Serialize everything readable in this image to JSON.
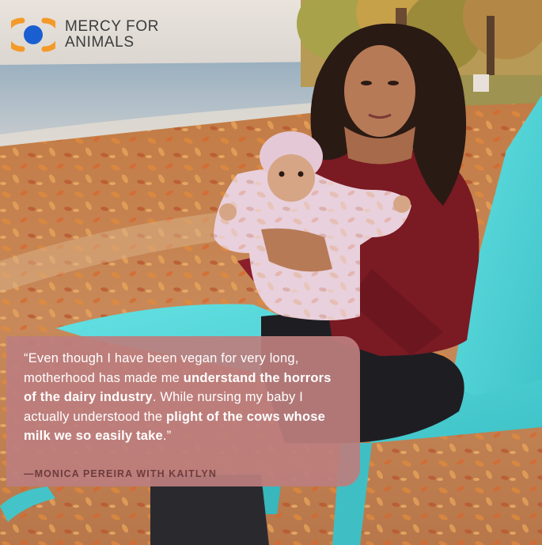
{
  "brand": {
    "line1": "MERCY FOR",
    "line2": "ANIMALS",
    "logo_colors": {
      "ring": "#f39a2b",
      "dot": "#1a5fd1"
    }
  },
  "quote": {
    "open": "“Even though I have been vegan for very long, motherhood has made me ",
    "bold1": "understand the horrors of the dairy industry",
    "mid": ". While nursing my baby I actually understood the ",
    "bold2": "plight of the cows whose milk we so easily take",
    "close": ".”",
    "attribution": "—MONICA PEREIRA WITH KAITLYN"
  },
  "colors": {
    "quote_bg": "#bc7e7e",
    "chair": "#4fd3d6",
    "sweater": "#7a1a22",
    "sand": "#c88a55"
  }
}
